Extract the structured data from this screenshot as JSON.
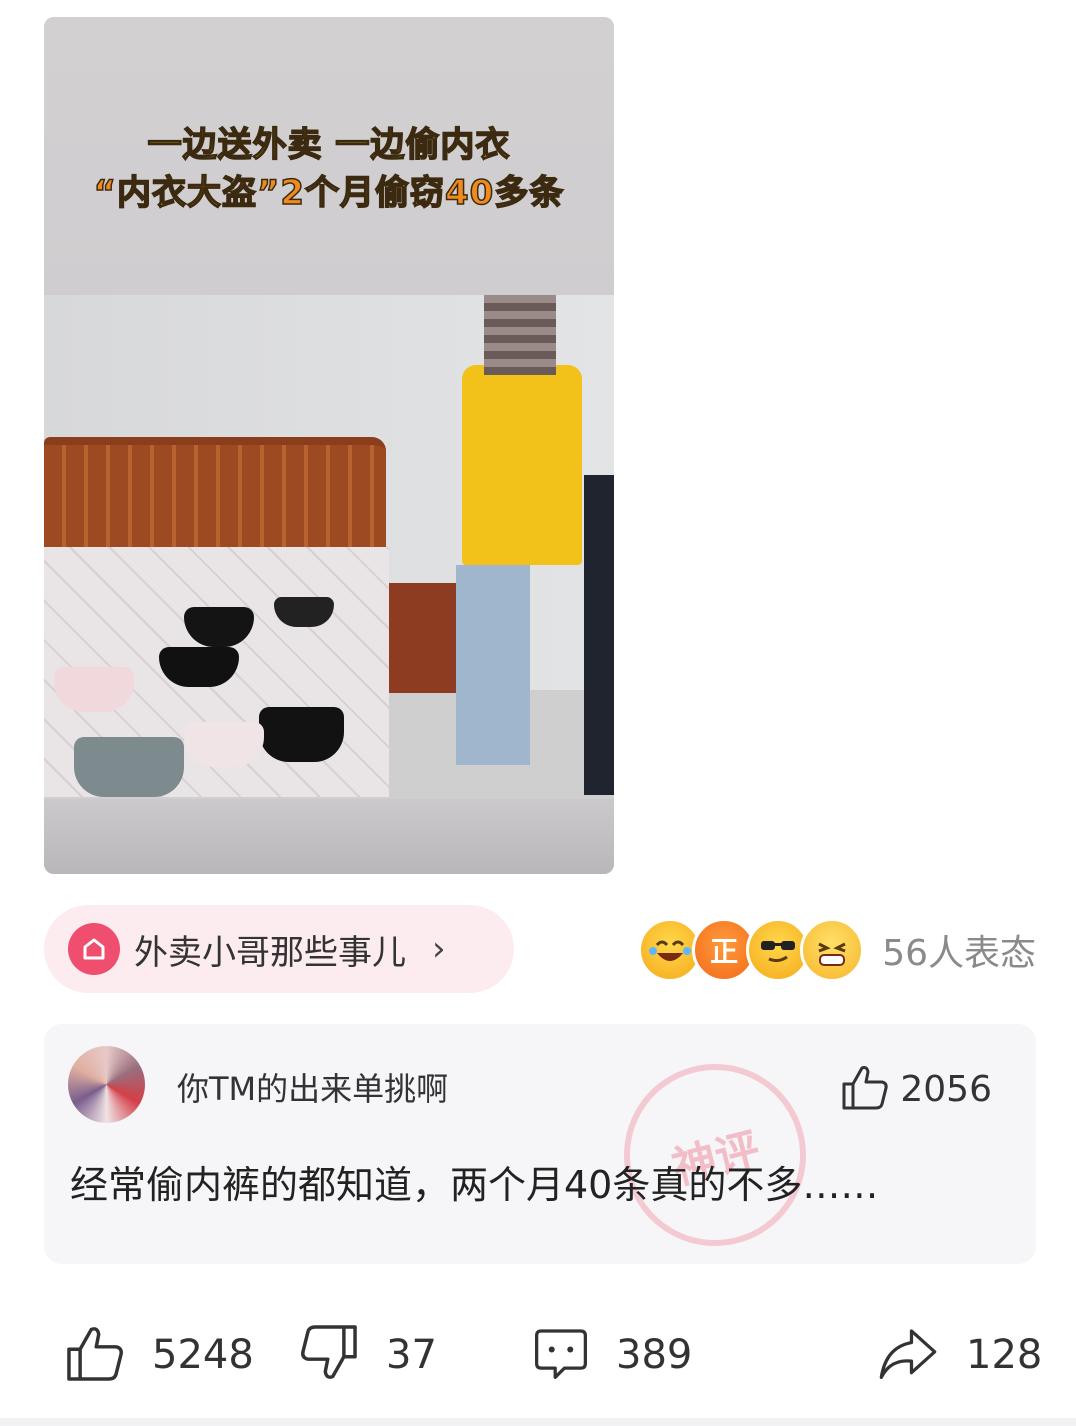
{
  "media": {
    "caption_line1": "一边送外卖 一边偷内衣",
    "caption_line2": "“内衣大盗”2个月偷窃40多条"
  },
  "topic": {
    "label": "外卖小哥那些事儿",
    "icon": "house-icon",
    "chevron": "›"
  },
  "reactions": {
    "emojis": [
      "laugh-cry-emoji",
      "zheng-badge-emoji",
      "sunglasses-emoji",
      "grin-emoji"
    ],
    "badge_text": "正",
    "count_label": "56人表态"
  },
  "comment": {
    "username": "你TM的出来单挑啊",
    "likes": "2056",
    "text": "经常偷内裤的都知道，两个月40条真的不多……",
    "watermark": "神评"
  },
  "actions": {
    "like": "5248",
    "dislike": "37",
    "comment": "389",
    "share": "128"
  },
  "colors": {
    "accent": "#ef4e6e",
    "pill_bg": "#fdecef",
    "card_bg": "#f6f6f8"
  }
}
